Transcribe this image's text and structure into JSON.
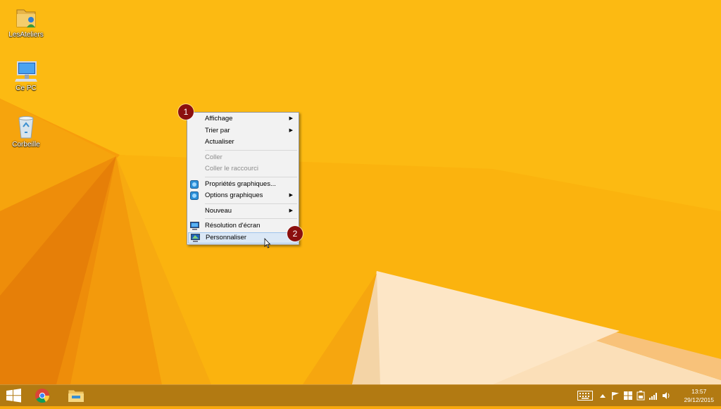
{
  "desktop": {
    "icons": [
      {
        "label": "LesAteliers",
        "icon": "folder-user-icon"
      },
      {
        "label": "Ce PC",
        "icon": "computer-icon"
      },
      {
        "label": "Corbeille",
        "icon": "recycle-bin-icon"
      }
    ]
  },
  "context_menu": {
    "items": [
      {
        "label": "Affichage",
        "submenu": true
      },
      {
        "label": "Trier par",
        "submenu": true
      },
      {
        "label": "Actualiser"
      },
      {
        "label": "Coller",
        "disabled": true
      },
      {
        "label": "Coller le raccourci",
        "disabled": true
      },
      {
        "label": "Propriétés graphiques...",
        "icon": "graphics-icon"
      },
      {
        "label": "Options graphiques",
        "submenu": true,
        "icon": "graphics-icon"
      },
      {
        "label": "Nouveau",
        "submenu": true
      },
      {
        "label": "Résolution d'écran",
        "icon": "monitor-icon"
      },
      {
        "label": "Personnaliser",
        "icon": "personalize-icon",
        "hovered": true
      }
    ]
  },
  "badges": [
    "1",
    "2"
  ],
  "taskbar": {
    "pinned": [
      "windows-start-icon",
      "chrome-icon",
      "file-explorer-icon"
    ],
    "tray_icons": [
      "keyboard-icon",
      "chevron-up-icon",
      "flag-icon",
      "windows-update-icon",
      "battery-icon",
      "network-signal-icon",
      "volume-icon"
    ],
    "time": "13:57",
    "date": "29/12/2015"
  },
  "colors": {
    "wallpaper": "#f9a80c",
    "taskbar": "#b27a12",
    "badge": "#8b0f0f",
    "menu_bg": "#f2f2f2",
    "menu_hover": "#dbe8f6"
  }
}
